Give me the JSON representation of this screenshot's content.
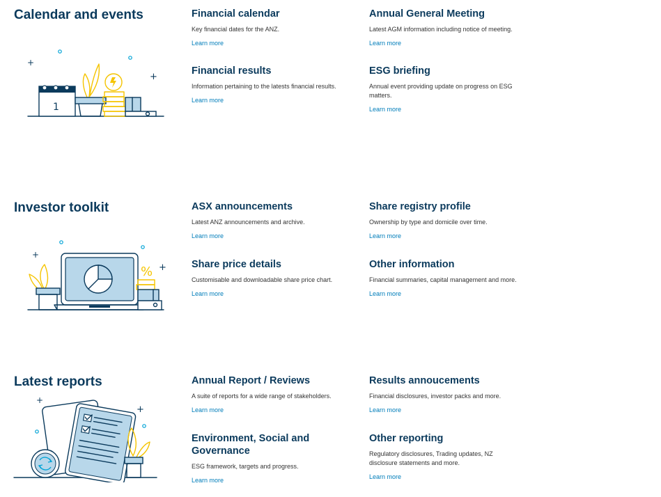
{
  "sections": [
    {
      "title": "Calendar and events",
      "cards": [
        {
          "title": "Financial calendar",
          "desc": "Key financial dates for the ANZ.",
          "link": "Learn more"
        },
        {
          "title": "Annual General Meeting",
          "desc": "Latest AGM information including notice of meeting.",
          "link": "Learn more"
        },
        {
          "title": "Financial results",
          "desc": "Information pertaining to the latests financial results.",
          "link": "Learn more"
        },
        {
          "title": "ESG briefing",
          "desc": "Annual event providing update on progress on ESG matters.",
          "link": "Learn more"
        }
      ],
      "illustration": {
        "calendar_day": "1",
        "icon": "calendar-coins-illustration"
      }
    },
    {
      "title": "Investor toolkit",
      "cards": [
        {
          "title": "ASX announcements",
          "desc": "Latest ANZ announcements and archive.",
          "link": "Learn more"
        },
        {
          "title": "Share registry profile",
          "desc": "Ownership by type and domicile over time.",
          "link": "Learn more"
        },
        {
          "title": "Share price details",
          "desc": "Customisable and downloadable share price chart.",
          "link": "Learn more"
        },
        {
          "title": "Other information",
          "desc": "Financial summaries, capital management and more.",
          "link": "Learn more"
        }
      ],
      "illustration": {
        "percent_symbol": "%",
        "icon": "laptop-pie-chart-illustration"
      }
    },
    {
      "title": "Latest reports",
      "cards": [
        {
          "title": "Annual Report / Reviews",
          "desc": "A suite of reports for a wide range of stakeholders.",
          "link": "Learn more"
        },
        {
          "title": "Results annoucements",
          "desc": "Financial disclosures, investor packs and more.",
          "link": "Learn more"
        },
        {
          "title": "Environment, Social and Governance",
          "desc": "ESG framework, targets and progress.",
          "link": "Learn more"
        },
        {
          "title": "Other reporting",
          "desc": "Regulatory disclosures, Trading updates, NZ disclosure statements and more.",
          "link": "Learn more"
        }
      ],
      "illustration": {
        "icon": "reports-checklist-illustration"
      }
    }
  ],
  "colors": {
    "heading": "#0b3a5c",
    "link": "#007dba",
    "accent_yellow": "#f5c400",
    "light_blue": "#b8d7ea",
    "cyan": "#00a3d6"
  }
}
